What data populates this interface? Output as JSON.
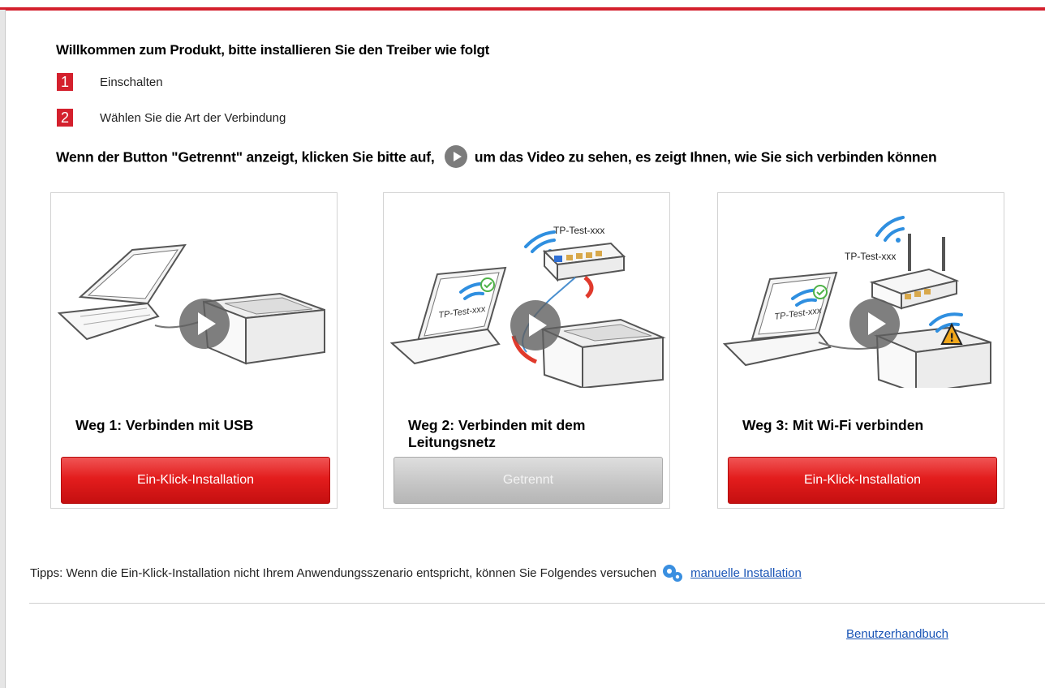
{
  "window": {
    "accent_color": "#d4202d"
  },
  "heading": "Willkommen zum Produkt, bitte installieren Sie den Treiber wie folgt",
  "steps": [
    {
      "number": "1",
      "text": "Einschalten"
    },
    {
      "number": "2",
      "text": "Wählen Sie die Art der Verbindung"
    }
  ],
  "instruction": {
    "before": "Wenn der Button \"Getrennt\" anzeigt, klicken Sie bitte auf,",
    "after": "um das Video zu sehen, es zeigt Ihnen, wie Sie sich verbinden können"
  },
  "cards": [
    {
      "title": "Weg 1: Verbinden mit USB",
      "button": "Ein-Klick-Installation",
      "button_state": "enabled"
    },
    {
      "title": "Weg 2: Verbinden mit dem Leitungsnetz",
      "button": "Getrennt",
      "button_state": "disabled",
      "label": "TP-Test-xxx",
      "laptop_label": "TP-Test-xxx"
    },
    {
      "title": "Weg 3: Mit Wi-Fi verbinden",
      "button": "Ein-Klick-Installation",
      "button_state": "enabled",
      "label": "TP-Test-xxx",
      "laptop_label": "TP-Test-xxx"
    }
  ],
  "tips": {
    "text": "Tipps: Wenn die Ein-Klick-Installation nicht Ihrem Anwendungsszenario entspricht, können Sie Folgendes versuchen",
    "link": "manuelle Installation"
  },
  "footer": {
    "manual_link": "Benutzerhandbuch"
  },
  "icons": [
    "play-icon",
    "gear-icon",
    "wifi-icon",
    "check-icon",
    "warning-icon",
    "laptop-icon",
    "printer-icon",
    "router-icon"
  ]
}
